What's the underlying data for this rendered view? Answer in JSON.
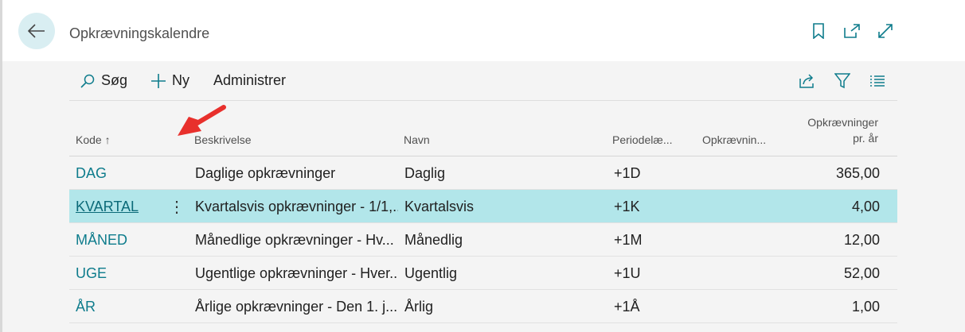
{
  "header": {
    "title": "Opkrævningskalendre",
    "icons": [
      "back-arrow-icon",
      "bookmark-icon",
      "open-new-window-icon",
      "expand-icon"
    ]
  },
  "toolbar": {
    "search_label": "Søg",
    "new_label": "Ny",
    "manage_label": "Administrer",
    "right_icons": [
      "share-icon",
      "filter-icon",
      "list-view-icon"
    ]
  },
  "table": {
    "headers": {
      "code": "Kode",
      "code_sort": "↑",
      "description": "Beskrivelse",
      "name": "Navn",
      "period": "Periodelæ...",
      "collections": "Opkrævnin...",
      "per_year_line1": "Opkrævninger",
      "per_year_line2": "pr. år"
    },
    "rows": [
      {
        "code": "DAG",
        "description": "Daglige opkrævninger",
        "name": "Daglig",
        "period": "+1D",
        "collections": "",
        "per_year": "365,00"
      },
      {
        "code": "KVARTAL",
        "description": "Kvartalsvis opkrævninger - 1/1,...",
        "name": "Kvartalsvis",
        "period": "+1K",
        "collections": "",
        "per_year": "4,00"
      },
      {
        "code": "MÅNED",
        "description": "Månedlige opkrævninger - Hv...",
        "name": "Månedlig",
        "period": "+1M",
        "collections": "",
        "per_year": "12,00"
      },
      {
        "code": "UGE",
        "description": "Ugentlige opkrævninger - Hver...",
        "name": "Ugentlig",
        "period": "+1U",
        "collections": "",
        "per_year": "52,00"
      },
      {
        "code": "ÅR",
        "description": "Årlige opkrævninger - Den 1. j...",
        "name": "Årlig",
        "period": "+1Å",
        "collections": "",
        "per_year": "1,00"
      }
    ],
    "selected_row_index": 1,
    "row_menu_glyph": "⋮"
  },
  "colors": {
    "accent": "#0e7c8c",
    "selected_row": "#b2e6ea",
    "back_button": "#d9eef2",
    "annotation_arrow": "#e8302c"
  }
}
